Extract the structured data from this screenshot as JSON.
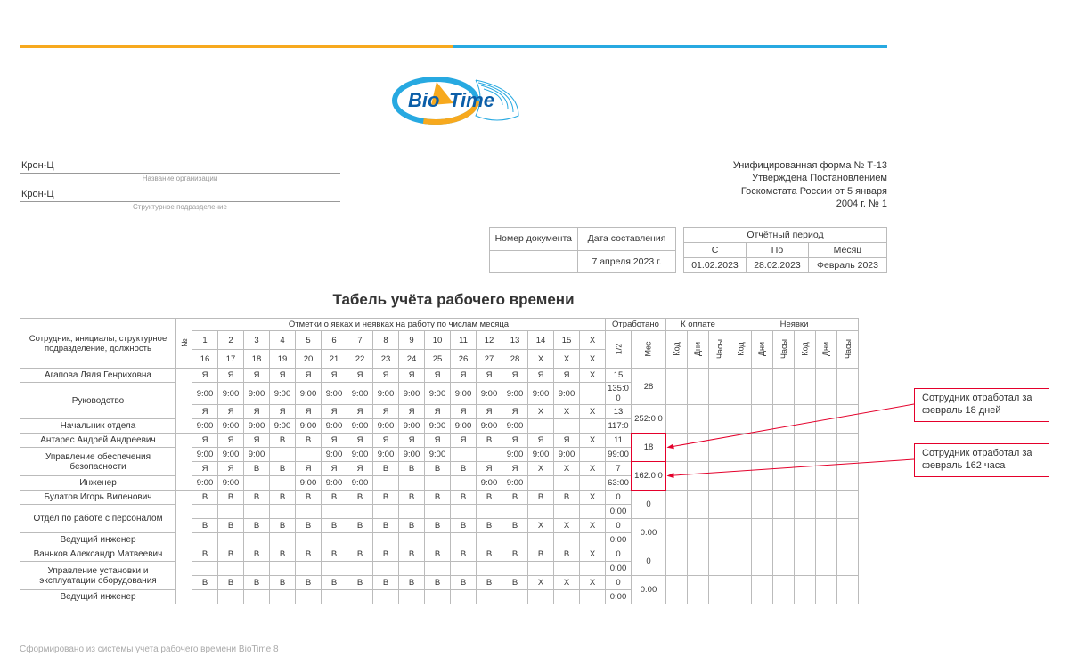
{
  "org_name": "Крон-Ц",
  "org_caption": "Название организации",
  "dept_name": "Крон-Ц",
  "dept_caption": "Структурное подразделение",
  "form_lines": [
    "Унифицированная форма № Т-13",
    "Утверждена Постановлением",
    "Госкомстата России от 5 января",
    "2004 г. № 1"
  ],
  "doc": {
    "h_num": "Номер документа",
    "h_date": "Дата составления",
    "num": "",
    "date": "7 апреля 2023 г."
  },
  "period": {
    "h": "Отчётный период",
    "h_from": "С",
    "h_to": "По",
    "h_month": "Месяц",
    "from": "01.02.2023",
    "to": "28.02.2023",
    "month": "Февраль 2023"
  },
  "title": "Табель учёта рабочего времени",
  "head": {
    "emp": "Сотрудник, инициалы, структурное подразделение, должность",
    "n": "№",
    "marks": "Отметки о явках и неявках на работу по числам месяца",
    "worked": "Отработано",
    "pay": "К оплате",
    "absent": "Неявки",
    "half": "1/2",
    "mes": "Мес",
    "kod": "Код",
    "dni": "Дни",
    "chasy": "Часы"
  },
  "days_r1": [
    "1",
    "2",
    "3",
    "4",
    "5",
    "6",
    "7",
    "8",
    "9",
    "10",
    "11",
    "12",
    "13",
    "14",
    "15",
    "X"
  ],
  "days_r2": [
    "16",
    "17",
    "18",
    "19",
    "20",
    "21",
    "22",
    "23",
    "24",
    "25",
    "26",
    "27",
    "28",
    "X",
    "X",
    "X"
  ],
  "employees": [
    {
      "name": "Агапова Ляля Генриховна",
      "dept": "Руководство",
      "pos": "Начальник отдела",
      "rows": [
        {
          "cells": [
            "Я",
            "Я",
            "Я",
            "Я",
            "Я",
            "Я",
            "Я",
            "Я",
            "Я",
            "Я",
            "Я",
            "Я",
            "Я",
            "Я",
            "Я",
            "X"
          ],
          "half": "15"
        },
        {
          "cells": [
            "9:00",
            "9:00",
            "9:00",
            "9:00",
            "9:00",
            "9:00",
            "9:00",
            "9:00",
            "9:00",
            "9:00",
            "9:00",
            "9:00",
            "9:00",
            "9:00",
            "9:00",
            ""
          ],
          "half": "135:0 0"
        },
        {
          "cells": [
            "Я",
            "Я",
            "Я",
            "Я",
            "Я",
            "Я",
            "Я",
            "Я",
            "Я",
            "Я",
            "Я",
            "Я",
            "Я",
            "X",
            "X",
            "X"
          ],
          "half": "13"
        },
        {
          "cells": [
            "9:00",
            "9:00",
            "9:00",
            "9:00",
            "9:00",
            "9:00",
            "9:00",
            "9:00",
            "9:00",
            "9:00",
            "9:00",
            "9:00",
            "9:00",
            "",
            "",
            ""
          ],
          "half": "117:0"
        }
      ],
      "mes_days": "28",
      "mes_hours": "252:0 0"
    },
    {
      "name": "Антарес Андрей Андреевич",
      "dept": "Управление обеспечения безопасности",
      "pos": "Инженер",
      "rows": [
        {
          "cells": [
            "Я",
            "Я",
            "Я",
            "В",
            "В",
            "Я",
            "Я",
            "Я",
            "Я",
            "Я",
            "Я",
            "В",
            "Я",
            "Я",
            "Я",
            "X"
          ],
          "half": "11"
        },
        {
          "cells": [
            "9:00",
            "9:00",
            "9:00",
            "",
            "",
            "9:00",
            "9:00",
            "9:00",
            "9:00",
            "9:00",
            "",
            "",
            "9:00",
            "9:00",
            "9:00",
            ""
          ],
          "half": "99:00"
        },
        {
          "cells": [
            "Я",
            "Я",
            "В",
            "В",
            "Я",
            "Я",
            "Я",
            "В",
            "В",
            "В",
            "В",
            "Я",
            "Я",
            "X",
            "X",
            "X"
          ],
          "half": "7"
        },
        {
          "cells": [
            "9:00",
            "9:00",
            "",
            "",
            "9:00",
            "9:00",
            "9:00",
            "",
            "",
            "",
            "",
            "9:00",
            "9:00",
            "",
            "",
            ""
          ],
          "half": "63:00"
        }
      ],
      "mes_days": "18",
      "mes_hours": "162:0 0"
    },
    {
      "name": "Булатов Игорь Виленович",
      "dept": "Отдел по работе с персоналом",
      "pos": "Ведущий инженер",
      "rows": [
        {
          "cells": [
            "В",
            "В",
            "В",
            "В",
            "В",
            "В",
            "В",
            "В",
            "В",
            "В",
            "В",
            "В",
            "В",
            "В",
            "В",
            "X"
          ],
          "half": "0"
        },
        {
          "cells": [
            "",
            "",
            "",
            "",
            "",
            "",
            "",
            "",
            "",
            "",
            "",
            "",
            "",
            "",
            "",
            ""
          ],
          "half": "0:00"
        },
        {
          "cells": [
            "В",
            "В",
            "В",
            "В",
            "В",
            "В",
            "В",
            "В",
            "В",
            "В",
            "В",
            "В",
            "В",
            "X",
            "X",
            "X"
          ],
          "half": "0"
        },
        {
          "cells": [
            "",
            "",
            "",
            "",
            "",
            "",
            "",
            "",
            "",
            "",
            "",
            "",
            "",
            "",
            "",
            ""
          ],
          "half": "0:00"
        }
      ],
      "mes_days": "0",
      "mes_hours": "0:00"
    },
    {
      "name": "Ваньков Александр Матвеевич",
      "dept": "Управление установки и эксплуатации оборудования",
      "pos": "Ведущий инженер",
      "rows": [
        {
          "cells": [
            "В",
            "В",
            "В",
            "В",
            "В",
            "В",
            "В",
            "В",
            "В",
            "В",
            "В",
            "В",
            "В",
            "В",
            "В",
            "X"
          ],
          "half": "0"
        },
        {
          "cells": [
            "",
            "",
            "",
            "",
            "",
            "",
            "",
            "",
            "",
            "",
            "",
            "",
            "",
            "",
            "",
            ""
          ],
          "half": "0:00"
        },
        {
          "cells": [
            "В",
            "В",
            "В",
            "В",
            "В",
            "В",
            "В",
            "В",
            "В",
            "В",
            "В",
            "В",
            "В",
            "X",
            "X",
            "X"
          ],
          "half": "0"
        },
        {
          "cells": [
            "",
            "",
            "",
            "",
            "",
            "",
            "",
            "",
            "",
            "",
            "",
            "",
            "",
            "",
            "",
            ""
          ],
          "half": "0:00"
        }
      ],
      "mes_days": "0",
      "mes_hours": "0:00"
    }
  ],
  "callouts": {
    "c1": "Сотрудник отработал за февраль 18 дней",
    "c2": "Сотрудник отработал за февраль 162 часа"
  },
  "footer": "Сформировано из системы учета рабочего времени BioTime 8",
  "logo_text_a": "Bio",
  "logo_text_b": "Time"
}
